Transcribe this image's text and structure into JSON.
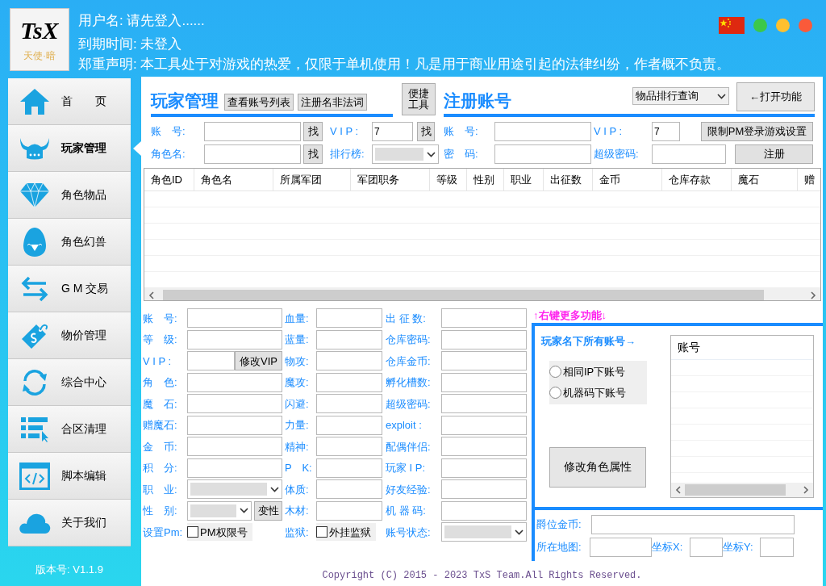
{
  "header": {
    "logo": {
      "title": "TsX",
      "subtitle": "天使·暗"
    },
    "lines": [
      "用户名: 请先登入......",
      "到期时间: 未登入",
      "郑重声明: 本工具处于对游戏的热爱，仅限于单机使用！凡是用于商业用途引起的法律纠纷，作者概不负责。"
    ],
    "window_dots": [
      {
        "color": "#3cc84a"
      },
      {
        "color": "#ffc02e"
      },
      {
        "color": "#fa5a3a"
      }
    ]
  },
  "sidebar": {
    "items": [
      {
        "label": "首　　页",
        "selected": false
      },
      {
        "label": "玩家管理",
        "selected": true
      },
      {
        "label": "角色物品",
        "selected": false
      },
      {
        "label": "角色幻兽",
        "selected": false
      },
      {
        "label": "G M 交易",
        "selected": false
      },
      {
        "label": "物价管理",
        "selected": false
      },
      {
        "label": "综合中心",
        "selected": false
      },
      {
        "label": "合区清理",
        "selected": false
      },
      {
        "label": "脚本编辑",
        "selected": false
      },
      {
        "label": "关于我们",
        "selected": false
      }
    ],
    "version": "版本号: V1.1.9"
  },
  "player": {
    "title": "玩家管理",
    "buttons": [
      "查看账号列表",
      "注册名非法词"
    ],
    "quick_button": "便捷工具",
    "search_rows": [
      [
        {
          "kind": "label",
          "text": "账　号:"
        },
        {
          "kind": "input"
        },
        {
          "kind": "button",
          "text": "找"
        },
        {
          "kind": "label",
          "text": "V I P :"
        },
        {
          "kind": "input",
          "value": "7"
        },
        {
          "kind": "button",
          "text": "找"
        }
      ],
      [
        {
          "kind": "label",
          "text": "角色名:"
        },
        {
          "kind": "input"
        },
        {
          "kind": "button",
          "text": "找"
        },
        {
          "kind": "label",
          "text": "排行榜:"
        },
        {
          "kind": "select"
        }
      ]
    ]
  },
  "register": {
    "title": "注册账号",
    "query_select": "物品排行查询",
    "open_button": "←打开功能",
    "rows": [
      [
        {
          "kind": "label",
          "text": "账　号:"
        },
        {
          "kind": "input"
        },
        {
          "kind": "label",
          "text": "V I P :"
        },
        {
          "kind": "input",
          "value": "7"
        },
        {
          "kind": "button",
          "text": "限制PM登录游戏设置"
        }
      ],
      [
        {
          "kind": "label",
          "text": "密　码:"
        },
        {
          "kind": "input"
        },
        {
          "kind": "label",
          "text": "超级密码:"
        },
        {
          "kind": "input"
        },
        {
          "kind": "button",
          "text": "注册"
        }
      ]
    ]
  },
  "table": {
    "columns": [
      "角色ID",
      "角色名",
      "所属军团",
      "军团职务",
      "等级",
      "性别",
      "职业",
      "出征数",
      "金币",
      "仓库存款",
      "魔石",
      "赠"
    ]
  },
  "details": {
    "columns": [
      [
        {
          "label": "账　号:",
          "kind": "input"
        },
        {
          "label": "等　级:",
          "kind": "input"
        },
        {
          "label": "V I P :",
          "kind": "input_button",
          "button": "修改VIP"
        },
        {
          "label": "角　色:",
          "kind": "input"
        },
        {
          "label": "魔　石:",
          "kind": "input"
        },
        {
          "label": "赠魔石:",
          "kind": "input"
        },
        {
          "label": "金　币:",
          "kind": "input"
        },
        {
          "label": "积　分:",
          "kind": "input"
        },
        {
          "label": "职　业:",
          "kind": "select"
        },
        {
          "label": "性　别:",
          "kind": "select_button",
          "button": "变性"
        },
        {
          "label": "设置Pm:",
          "kind": "checkbox",
          "text": "PM权限号",
          "checked": false
        }
      ],
      [
        {
          "label": "血量:",
          "kind": "input"
        },
        {
          "label": "蓝量:",
          "kind": "input"
        },
        {
          "label": "物攻:",
          "kind": "input"
        },
        {
          "label": "魔攻:",
          "kind": "input"
        },
        {
          "label": "闪避:",
          "kind": "input"
        },
        {
          "label": "力量:",
          "kind": "input"
        },
        {
          "label": "精神:",
          "kind": "input"
        },
        {
          "label": "P　K:",
          "kind": "input"
        },
        {
          "label": "体质:",
          "kind": "input"
        },
        {
          "label": "木材:",
          "kind": "input"
        },
        {
          "label": "监狱:",
          "kind": "checkbox",
          "text": "外挂监狱",
          "checked": false
        }
      ],
      [
        {
          "label": "出 征 数:",
          "kind": "input"
        },
        {
          "label": "仓库密码:",
          "kind": "input"
        },
        {
          "label": "仓库金币:",
          "kind": "input"
        },
        {
          "label": "孵化槽数:",
          "kind": "input"
        },
        {
          "label": "超级密码:",
          "kind": "input"
        },
        {
          "label": "exploit :",
          "kind": "input"
        },
        {
          "label": "配偶伴侣:",
          "kind": "input"
        },
        {
          "label": "玩家 I P:",
          "kind": "input"
        },
        {
          "label": "好友经验:",
          "kind": "input"
        },
        {
          "label": "机 器 码:",
          "kind": "input"
        },
        {
          "label": "账号状态:",
          "kind": "select"
        }
      ]
    ]
  },
  "right_panel": {
    "hint": "↑右键更多功能↓",
    "title": "玩家名下所有账号→",
    "radios": [
      {
        "label": "相同IP下账号",
        "selected": false
      },
      {
        "label": "机器码下账号",
        "selected": false
      }
    ],
    "button": "修改角色属性",
    "list": {
      "column": "账号"
    },
    "fields": [
      [
        {
          "label": "爵位金币:"
        }
      ],
      [
        {
          "label": "所在地图:"
        },
        {
          "label": "坐标X:"
        },
        {
          "label": "坐标Y:"
        }
      ]
    ]
  },
  "copyright": "Copyright (C) 2015 - 2023 TxS Team.All Rights Reserved."
}
